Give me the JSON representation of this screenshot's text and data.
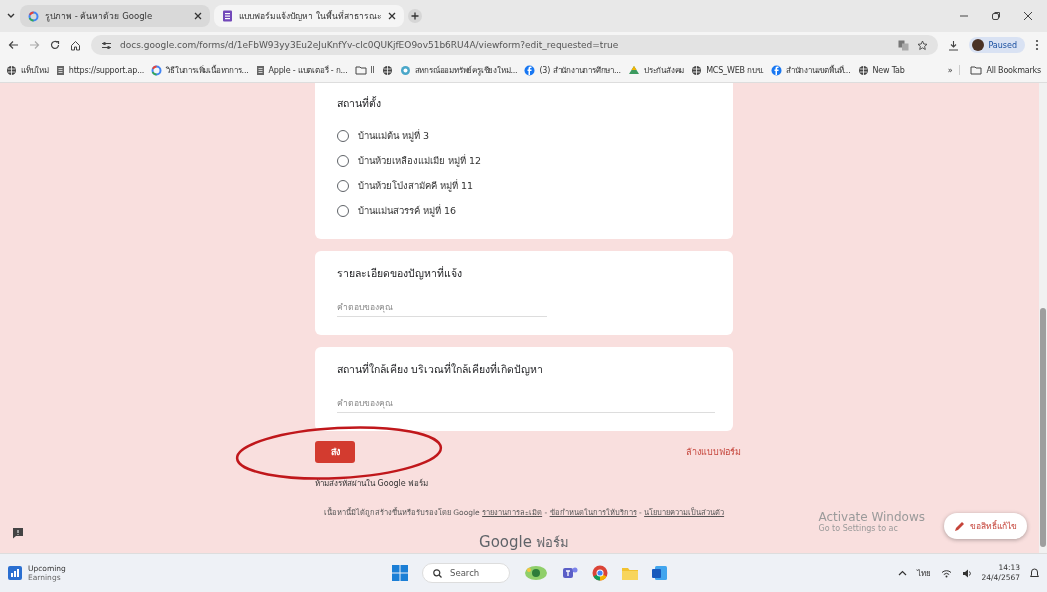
{
  "browser": {
    "tabs": [
      {
        "title": "รูปภาพ - ค้นหาด้วย Google",
        "kind": "google",
        "selected": false
      },
      {
        "title": "แบบฟอร์มแจ้งปัญหา ในพื้นที่สาธารณะ",
        "kind": "forms",
        "selected": true
      }
    ],
    "address": "docs.google.com/forms/d/1eFbW93yy3Eu2eJuKnfYv-clc0QUKjfEO9ov51b6RU4A/viewform?edit_requested=true",
    "profile": "Paused",
    "bookmarks": [
      {
        "kind": "globe",
        "label": "แท็บใหม่"
      },
      {
        "kind": "page",
        "label": "https://support.ap..."
      },
      {
        "kind": "google",
        "label": "วิธีในการเพิ่มเนื้อหาการ..."
      },
      {
        "kind": "page",
        "label": "Apple - แบตเตอรี่ - ก..."
      },
      {
        "kind": "folder",
        "label": "ll"
      },
      {
        "kind": "globe"
      },
      {
        "kind": "circle",
        "label": "สหกรณ์ออมทรัพย์ครูเชียงใหม่..."
      },
      {
        "kind": "facebook",
        "label": "(3) สำนักงานการศึกษา..."
      },
      {
        "kind": "drive",
        "label": "ประกันสังคม"
      },
      {
        "kind": "globe",
        "label": "MCS_WEB กบข."
      },
      {
        "kind": "facebook",
        "label": "สำนักงานเขตพื้นที่..."
      },
      {
        "kind": "globe",
        "label": "New Tab"
      }
    ],
    "bookmarks_more": "»",
    "all_bookmarks": "All Bookmarks"
  },
  "form": {
    "questions": [
      {
        "kind": "radio",
        "title": "สถานที่ตั้ง",
        "options": [
          {
            "label": "บ้านแม่ต้น หมู่ที่ 3",
            "selected": false
          },
          {
            "label": "บ้านห้วยเหลืองแม่เมีย หมู่ที่ 12",
            "selected": false
          },
          {
            "label": "บ้านห้วยโป่งสามัคคี หมู่ที่ 11",
            "selected": false
          },
          {
            "label": "บ้านแม่นสวรรค์ หมู่ที่ 16",
            "selected": false
          }
        ]
      },
      {
        "kind": "text",
        "title": "รายละเอียดของปัญหาที่แจ้ง",
        "placeholder": "คำตอบของคุณ"
      },
      {
        "kind": "text",
        "title": "สถานที่ใกล้เคียง บริเวณที่ใกล้เคียงที่เกิดปัญหา",
        "placeholder": "คำตอบของคุณ"
      }
    ],
    "submit": "ส่ง",
    "clear": "ล้างแบบฟอร์ม",
    "password_notice": "ห้ามส่งรหัสผ่านใน Google ฟอร์ม",
    "disclaimer": "เนื้อหานี้มิได้ถูกสร้างขึ้นหรือรับรองโดย Google",
    "links": [
      "รายงานการละเมิด",
      "ข้อกำหนดในการให้บริการ",
      "นโยบายความเป็นส่วนตัว"
    ],
    "link_separator": "-",
    "brand": "Google",
    "brand_suffix": "ฟอร์ม",
    "edit_request": "ขอสิทธิ์แก้ไข"
  },
  "activation": {
    "title": "Activate Windows",
    "subtitle": "Go to Settings to ac"
  },
  "taskbar": {
    "widget_title": "Upcoming",
    "widget_subtitle": "Earnings",
    "search": "Search",
    "language": "ไทย",
    "time": "14:13",
    "date": "24/4/2567"
  }
}
